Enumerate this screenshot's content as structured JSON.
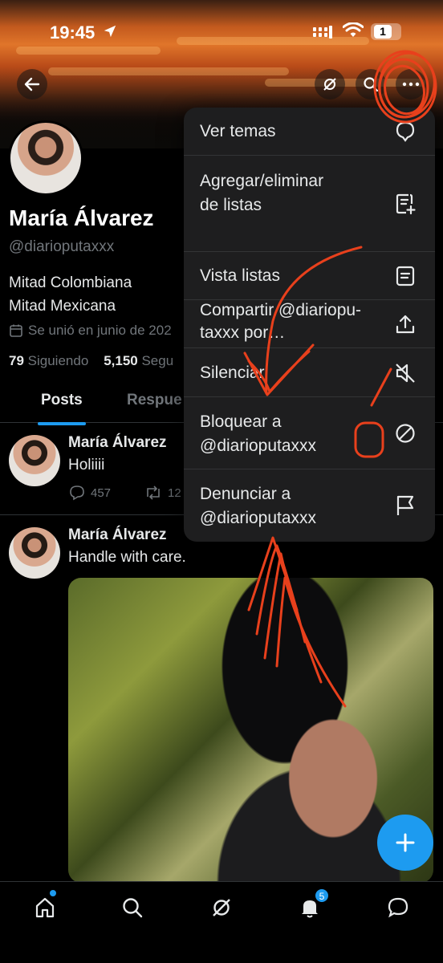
{
  "status_bar": {
    "time": "19:45",
    "battery": "1"
  },
  "profile": {
    "name": "María Álvarez",
    "handle": "@diarioputaxxx",
    "bio_line1": "Mitad Colombiana",
    "bio_line2": "Mitad Mexicana",
    "joined": "Se unió en junio de 202",
    "following_count": "79",
    "following_label": "Siguiendo",
    "followers_count": "5,150",
    "followers_label": "Segu"
  },
  "tabs": [
    "Posts",
    "Respue"
  ],
  "posts": [
    {
      "name": "María Álvarez",
      "text": "Holiiii",
      "replies": "457",
      "reposts": "12"
    },
    {
      "name": "María Álvarez",
      "text": "Handle with care."
    }
  ],
  "menu": {
    "items": [
      {
        "label": "Ver temas",
        "icon": "topics-icon"
      },
      {
        "label": "Agregar/eliminar\nde listas",
        "icon": "list-add-icon"
      },
      {
        "label": "Vista listas",
        "icon": "list-icon"
      },
      {
        "label": "Compartir @diarioputaxxx por…",
        "line1": "Compartir @diariopu-",
        "line2": "taxxx por…",
        "icon": "share-icon"
      },
      {
        "label": "Silenciar",
        "icon": "mute-icon"
      },
      {
        "label": "Bloquear a @diarioputaxxx",
        "line1": "Bloquear a",
        "line2": "@diarioputaxxx",
        "icon": "block-icon"
      },
      {
        "label": "Denunciar a @diarioputaxxx",
        "line1": "Denunciar a",
        "line2": "@diarioputaxxx",
        "icon": "flag-icon"
      }
    ]
  },
  "nav": {
    "notifications_badge": "5"
  },
  "colors": {
    "accent": "#1d9bf0",
    "annotation": "#e8401c"
  }
}
